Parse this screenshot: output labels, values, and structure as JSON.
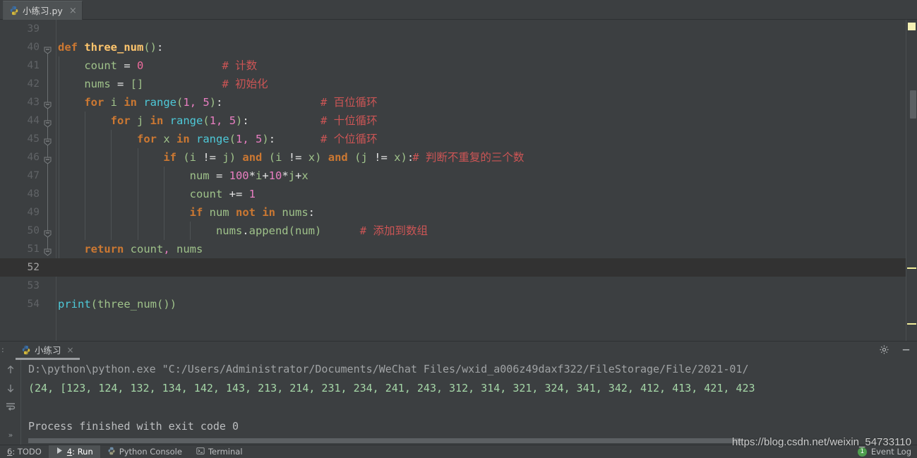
{
  "editor_tab": {
    "label": "小练习.py",
    "icon": "python-file-icon",
    "close": "×"
  },
  "code": {
    "first_line": 39,
    "caret_line": 52,
    "lines": [
      {
        "n": 39,
        "tokens": []
      },
      {
        "n": 40,
        "fold": "start",
        "tokens": [
          {
            "t": "def",
            "c": "kw"
          },
          {
            "t": " ",
            "c": "id"
          },
          {
            "t": "three_num",
            "c": "def"
          },
          {
            "t": "()",
            "c": "paren"
          },
          {
            "t": ":",
            "c": "wh"
          }
        ]
      },
      {
        "n": 41,
        "tokens": [
          {
            "t": "    count ",
            "c": "gr"
          },
          {
            "t": "= ",
            "c": "wh"
          },
          {
            "t": "0",
            "c": "numpink"
          }
        ],
        "comment": "# 计数",
        "comment_col": 25
      },
      {
        "n": 42,
        "tokens": [
          {
            "t": "    nums ",
            "c": "gr"
          },
          {
            "t": "= ",
            "c": "wh"
          },
          {
            "t": "[]",
            "c": "gr"
          }
        ],
        "comment": "# 初始化",
        "comment_col": 25
      },
      {
        "n": 43,
        "fold": "start",
        "tokens": [
          {
            "t": "    ",
            "c": "id"
          },
          {
            "t": "for",
            "c": "kw"
          },
          {
            "t": " i ",
            "c": "gr"
          },
          {
            "t": "in",
            "c": "kw"
          },
          {
            "t": " ",
            "c": "id"
          },
          {
            "t": "range",
            "c": "cy"
          },
          {
            "t": "(",
            "c": "paren"
          },
          {
            "t": "1",
            "c": "mg"
          },
          {
            "t": ", ",
            "c": "mg"
          },
          {
            "t": "5",
            "c": "mg"
          },
          {
            "t": ")",
            "c": "paren"
          },
          {
            "t": ":",
            "c": "wh"
          }
        ],
        "comment": "# 百位循环",
        "comment_col": 40
      },
      {
        "n": 44,
        "fold": "start",
        "tokens": [
          {
            "t": "        ",
            "c": "id"
          },
          {
            "t": "for",
            "c": "kw"
          },
          {
            "t": " j ",
            "c": "gr"
          },
          {
            "t": "in",
            "c": "kw"
          },
          {
            "t": " ",
            "c": "id"
          },
          {
            "t": "range",
            "c": "cy"
          },
          {
            "t": "(",
            "c": "paren"
          },
          {
            "t": "1",
            "c": "mg"
          },
          {
            "t": ", ",
            "c": "mg"
          },
          {
            "t": "5",
            "c": "mg"
          },
          {
            "t": ")",
            "c": "paren"
          },
          {
            "t": ":",
            "c": "wh"
          }
        ],
        "comment": "# 十位循环",
        "comment_col": 40
      },
      {
        "n": 45,
        "fold": "start",
        "tokens": [
          {
            "t": "            ",
            "c": "id"
          },
          {
            "t": "for",
            "c": "kw"
          },
          {
            "t": " x ",
            "c": "gr"
          },
          {
            "t": "in",
            "c": "kw"
          },
          {
            "t": " ",
            "c": "id"
          },
          {
            "t": "range",
            "c": "cy"
          },
          {
            "t": "(",
            "c": "paren"
          },
          {
            "t": "1",
            "c": "mg"
          },
          {
            "t": ", ",
            "c": "mg"
          },
          {
            "t": "5",
            "c": "mg"
          },
          {
            "t": ")",
            "c": "paren"
          },
          {
            "t": ":",
            "c": "wh"
          }
        ],
        "comment": "# 个位循环",
        "comment_col": 40
      },
      {
        "n": 46,
        "fold": "start",
        "tokens": [
          {
            "t": "                ",
            "c": "id"
          },
          {
            "t": "if",
            "c": "kw"
          },
          {
            "t": " ",
            "c": "id"
          },
          {
            "t": "(",
            "c": "paren"
          },
          {
            "t": "i ",
            "c": "gr"
          },
          {
            "t": "!=",
            "c": "wh"
          },
          {
            "t": " j",
            "c": "gr"
          },
          {
            "t": ")",
            "c": "paren"
          },
          {
            "t": " ",
            "c": "id"
          },
          {
            "t": "and",
            "c": "kw"
          },
          {
            "t": " ",
            "c": "id"
          },
          {
            "t": "(",
            "c": "paren"
          },
          {
            "t": "i ",
            "c": "gr"
          },
          {
            "t": "!=",
            "c": "wh"
          },
          {
            "t": " x",
            "c": "gr"
          },
          {
            "t": ")",
            "c": "paren"
          },
          {
            "t": " ",
            "c": "id"
          },
          {
            "t": "and",
            "c": "kw"
          },
          {
            "t": " ",
            "c": "id"
          },
          {
            "t": "(",
            "c": "paren"
          },
          {
            "t": "j ",
            "c": "gr"
          },
          {
            "t": "!=",
            "c": "wh"
          },
          {
            "t": " x",
            "c": "gr"
          },
          {
            "t": ")",
            "c": "paren"
          },
          {
            "t": ":",
            "c": "wh"
          }
        ],
        "comment": "# 判断不重复的三个数",
        "comment_col": 54
      },
      {
        "n": 47,
        "tokens": [
          {
            "t": "                    num ",
            "c": "gr"
          },
          {
            "t": "= ",
            "c": "wh"
          },
          {
            "t": "100",
            "c": "mg"
          },
          {
            "t": "*",
            "c": "wh"
          },
          {
            "t": "i",
            "c": "gr"
          },
          {
            "t": "+",
            "c": "wh"
          },
          {
            "t": "10",
            "c": "mg"
          },
          {
            "t": "*",
            "c": "wh"
          },
          {
            "t": "j",
            "c": "gr"
          },
          {
            "t": "+",
            "c": "wh"
          },
          {
            "t": "x",
            "c": "gr"
          }
        ]
      },
      {
        "n": 48,
        "tokens": [
          {
            "t": "                    count ",
            "c": "gr"
          },
          {
            "t": "+= ",
            "c": "wh"
          },
          {
            "t": "1",
            "c": "mg"
          }
        ]
      },
      {
        "n": 49,
        "tokens": [
          {
            "t": "                    ",
            "c": "id"
          },
          {
            "t": "if",
            "c": "kw"
          },
          {
            "t": " num ",
            "c": "gr"
          },
          {
            "t": "not",
            "c": "kw"
          },
          {
            "t": " ",
            "c": "id"
          },
          {
            "t": "in",
            "c": "kw"
          },
          {
            "t": " nums",
            "c": "gr"
          },
          {
            "t": ":",
            "c": "wh"
          }
        ]
      },
      {
        "n": 50,
        "fold": "start",
        "tokens": [
          {
            "t": "                        nums",
            "c": "gr"
          },
          {
            "t": ".",
            "c": "wh"
          },
          {
            "t": "append",
            "c": "gr"
          },
          {
            "t": "(",
            "c": "paren"
          },
          {
            "t": "num",
            "c": "gr"
          },
          {
            "t": ")",
            "c": "paren"
          }
        ],
        "comment": "# 添加到数组",
        "comment_col": 46
      },
      {
        "n": 51,
        "fold": "end",
        "tokens": [
          {
            "t": "    ",
            "c": "id"
          },
          {
            "t": "return",
            "c": "kw"
          },
          {
            "t": " count",
            "c": "gr"
          },
          {
            "t": ",",
            "c": "mg"
          },
          {
            "t": " nums",
            "c": "gr"
          }
        ]
      },
      {
        "n": 52,
        "tokens": [],
        "caret": true
      },
      {
        "n": 53,
        "tokens": []
      },
      {
        "n": 54,
        "tokens": [
          {
            "t": "print",
            "c": "cy"
          },
          {
            "t": "(",
            "c": "paren"
          },
          {
            "t": "three_num",
            "c": "gr"
          },
          {
            "t": "()",
            "c": "paren"
          },
          {
            "t": ")",
            "c": "paren"
          }
        ]
      }
    ]
  },
  "console": {
    "prefix": ":",
    "tab_label": "小练习",
    "tab_icon": "python-icon",
    "tab_close": "×",
    "settings_icon": "gear-icon",
    "minimize_icon": "minimize-icon",
    "toolbar": [
      "up-arrow-icon",
      "down-arrow-icon",
      "soft-wrap-icon",
      "expand-icon"
    ],
    "expand_label": "»",
    "output": [
      {
        "text": "D:\\python\\python.exe \"C:/Users/Administrator/Documents/WeChat Files/wxid_a006z49daxf322/FileStorage/File/2021-01/",
        "style": "out-path"
      },
      {
        "text": "(24, [123, 124, 132, 134, 142, 143, 213, 214, 231, 234, 241, 243, 312, 314, 321, 324, 341, 342, 412, 413, 421, 423",
        "style": "out-green"
      },
      {
        "text": "",
        "style": "out-grey"
      },
      {
        "text": "Process finished with exit code 0",
        "style": "out-grey"
      }
    ]
  },
  "statusbar": {
    "items": [
      {
        "label": "6: TODO",
        "icon": null,
        "active": false
      },
      {
        "label": "4: Run",
        "icon": "run-icon",
        "active": true
      },
      {
        "label": "Python Console",
        "icon": "python-icon",
        "active": false
      },
      {
        "label": "Terminal",
        "icon": "terminal-icon",
        "active": false
      }
    ],
    "event_log": {
      "label": "Event Log",
      "count": "1"
    }
  },
  "watermark": "https://blog.csdn.net/weixin_54733110",
  "colors": {
    "background": "#3c3f41",
    "caret_line": "#323232",
    "keyword": "#cc7832",
    "function": "#ffc66d",
    "string_green": "#9fc28a",
    "comment": "#cc5555",
    "number": "#ed6b9c",
    "cyan": "#4ec9d8",
    "marker_yellow": "#f0ec9a",
    "badge_green": "#4f9e4f"
  }
}
